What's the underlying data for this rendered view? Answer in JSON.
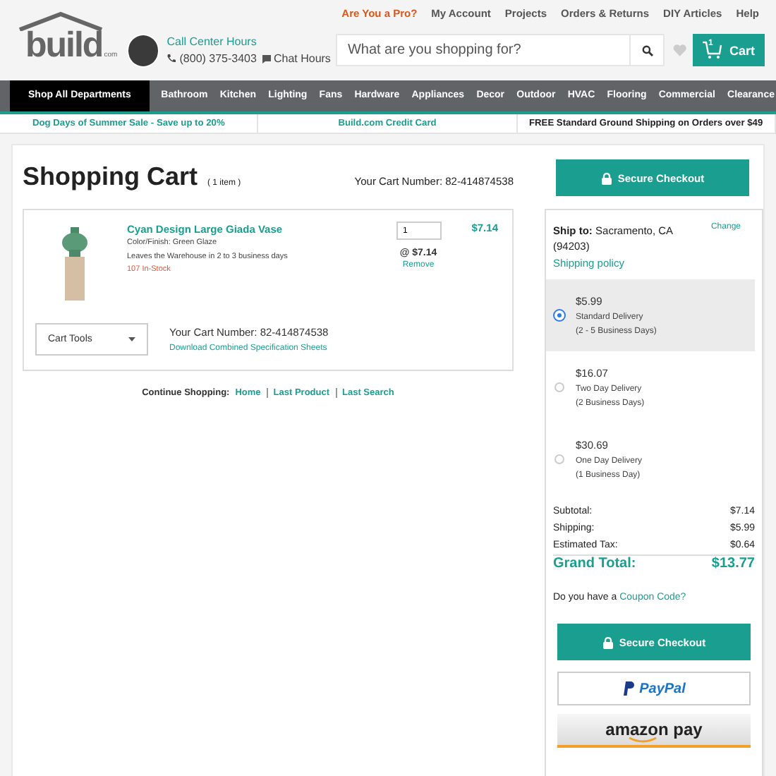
{
  "top_links": [
    {
      "label": "Are You a Pro?",
      "kind": "pro"
    },
    {
      "label": "My Account",
      "kind": "link"
    },
    {
      "label": "Projects",
      "kind": "link"
    },
    {
      "label": "Orders & Returns",
      "kind": "link"
    },
    {
      "label": "DIY Articles",
      "kind": "link"
    },
    {
      "label": "Help",
      "kind": "link"
    }
  ],
  "logo": {
    "text": "build",
    "suffix": "com"
  },
  "contact": {
    "title": "Call Center Hours",
    "phone": "(800) 375-3403",
    "chat": "Chat Hours"
  },
  "search": {
    "placeholder": "What are you shopping for?"
  },
  "cart_button": {
    "count": "1",
    "label": "Cart"
  },
  "nav": [
    {
      "label": "Shop All Departments",
      "kind": "all"
    },
    {
      "label": "Bathroom",
      "kind": "dept"
    },
    {
      "label": "Kitchen",
      "kind": "dept"
    },
    {
      "label": "Lighting",
      "kind": "dept"
    },
    {
      "label": "Fans",
      "kind": "dept"
    },
    {
      "label": "Hardware",
      "kind": "dept"
    },
    {
      "label": "Appliances",
      "kind": "dept"
    },
    {
      "label": "Decor",
      "kind": "dept"
    },
    {
      "label": "Outdoor",
      "kind": "dept"
    },
    {
      "label": "HVAC",
      "kind": "dept"
    },
    {
      "label": "Flooring",
      "kind": "dept"
    },
    {
      "label": "Commercial",
      "kind": "dept"
    },
    {
      "label": "Clearance",
      "kind": "dept"
    }
  ],
  "promos": [
    {
      "label": "Dog Days of Summer Sale - Save up to 20%",
      "kind": "link"
    },
    {
      "label": "Build.com Credit Card",
      "kind": "link"
    },
    {
      "label": "FREE Standard Ground Shipping on Orders over $49",
      "kind": "text"
    }
  ],
  "cart": {
    "title": "Shopping Cart",
    "count": "( 1 item )",
    "cart_number": "Your Cart Number: 82-414874538",
    "item": {
      "name": "Cyan Design Large Giada Vase",
      "finish": "Color/Finish: Green Glaze",
      "leaves": "Leaves the Warehouse in 2 to 3 business days",
      "stock": "107 In-Stock",
      "quantity": "1",
      "unit_price": "@ $7.14",
      "remove": "Remove",
      "total": "$7.14"
    },
    "tools": "Cart Tools",
    "cart_number_2": "Your Cart Number: 82-414874538",
    "download": "Download Combined Specification Sheets"
  },
  "continue": {
    "label": "Continue Shopping:",
    "links": [
      "Home",
      "Last Product",
      "Last Search"
    ]
  },
  "checkout_top": "Secure Checkout",
  "shipping": {
    "label": "Ship to:",
    "place": "Sacramento, CA (94203)",
    "change": "Change",
    "policy": "Shipping policy",
    "options": [
      {
        "price": "$5.99",
        "name": "Standard Delivery",
        "days": "(2 - 5 Business Days)",
        "selected": true
      },
      {
        "price": "$16.07",
        "name": "Two Day Delivery",
        "days": "(2 Business Days)",
        "selected": false
      },
      {
        "price": "$30.69",
        "name": "One Day Delivery",
        "days": "(1 Business Day)",
        "selected": false
      }
    ]
  },
  "totals": [
    {
      "label": "Subtotal:",
      "value": "$7.14"
    },
    {
      "label": "Shipping:",
      "value": "$5.99"
    },
    {
      "label": "Estimated Tax:",
      "value": "$0.64"
    }
  ],
  "grand_total": {
    "label": "Grand Total:",
    "value": "$13.77"
  },
  "coupon": {
    "text": "Do you have a",
    "link": "Coupon Code?"
  },
  "checkout_bottom": "Secure Checkout",
  "paypal": "PayPal",
  "amazon": "amazon pay"
}
